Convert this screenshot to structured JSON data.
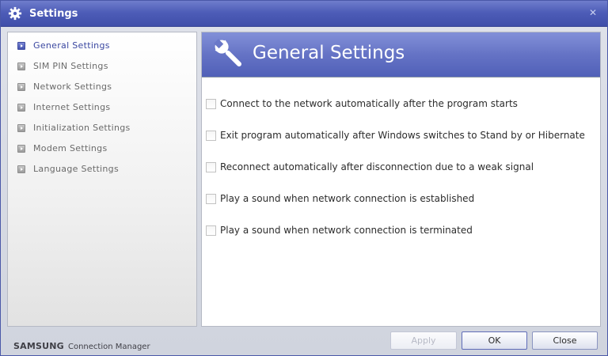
{
  "window": {
    "title": "Settings"
  },
  "sidebar": {
    "items": [
      {
        "label": "General Settings",
        "active": true
      },
      {
        "label": "SIM PIN Settings",
        "active": false
      },
      {
        "label": "Network Settings",
        "active": false
      },
      {
        "label": "Internet Settings",
        "active": false
      },
      {
        "label": "Initialization Settings",
        "active": false
      },
      {
        "label": "Modem Settings",
        "active": false
      },
      {
        "label": "Language Settings",
        "active": false
      }
    ]
  },
  "content": {
    "title": "General Settings",
    "icon": "wrench-icon",
    "options": [
      {
        "label": "Connect to the network automatically after the program starts",
        "checked": false
      },
      {
        "label": "Exit program automatically after Windows switches to Stand by or Hibernate",
        "checked": false
      },
      {
        "label": "Reconnect automatically after disconnection due to a weak signal",
        "checked": false
      },
      {
        "label": "Play a sound when network connection is established",
        "checked": false
      },
      {
        "label": "Play a sound when network connection is terminated",
        "checked": false
      }
    ]
  },
  "footer": {
    "brand": "SAMSUNG",
    "product": "Connection Manager",
    "apply_label": "Apply",
    "ok_label": "OK",
    "close_label": "Close"
  },
  "colors": {
    "title_bar": "#4e5db8",
    "accent": "#3a47a0"
  }
}
